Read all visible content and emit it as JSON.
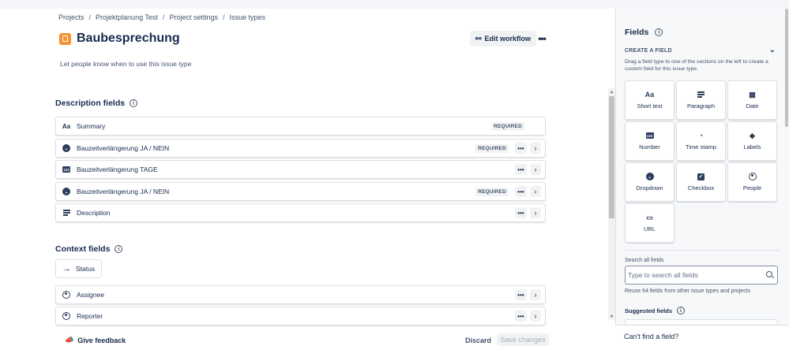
{
  "breadcrumb": [
    "Projects",
    "Projektplanung Test",
    "Project settings",
    "Issue types"
  ],
  "header": {
    "title": "Baubesprechung",
    "edit_workflow": "Edit workflow",
    "description": "Let people know when to use this issue type"
  },
  "description_fields": {
    "title": "Description fields",
    "rows": [
      {
        "icon": "text-icon",
        "label": "Summary",
        "required": "REQUIRED"
      },
      {
        "icon": "dropdown-icon",
        "label": "Bauzeitverlängerung JA / NEIN",
        "required": "REQUIRED"
      },
      {
        "icon": "number-icon",
        "label": "Bauzeitverlängerung TAGE",
        "required": ""
      },
      {
        "icon": "dropdown-icon",
        "label": "Bauzeitverlängerung JA / NEIN",
        "required": "REQUIRED"
      },
      {
        "icon": "paragraph-icon",
        "label": "Description",
        "required": ""
      }
    ]
  },
  "context_fields": {
    "title": "Context fields",
    "status": "Status",
    "rows": [
      {
        "icon": "person-icon",
        "label": "Assignee"
      },
      {
        "icon": "person-icon",
        "label": "Reporter"
      }
    ]
  },
  "footer": {
    "feedback": "Give feedback",
    "discard": "Discard",
    "save": "Save changes"
  },
  "sidebar": {
    "title": "Fields",
    "create_heading": "CREATE A FIELD",
    "create_desc": "Drag a field type to one of the sections on the left to create a custom field for this issue type.",
    "tiles": [
      {
        "icon": "text-icon",
        "label": "Short text"
      },
      {
        "icon": "paragraph-icon",
        "label": "Paragraph"
      },
      {
        "icon": "calendar-icon",
        "label": "Date"
      },
      {
        "icon": "number-icon",
        "label": "Number"
      },
      {
        "icon": "clock-icon",
        "label": "Time stamp"
      },
      {
        "icon": "tag-icon",
        "label": "Labels"
      },
      {
        "icon": "dropdown-icon",
        "label": "Dropdown"
      },
      {
        "icon": "checkbox-icon",
        "label": "Checkbox"
      },
      {
        "icon": "people-icon",
        "label": "People"
      },
      {
        "icon": "link-icon",
        "label": "URL"
      }
    ],
    "search_label": "Search all fields",
    "search_placeholder": "Type to search all fields",
    "reuse_text": "Reuse 64 fields from other issue types and projects",
    "suggested": "Suggested fields",
    "cant_find": "Can't find a field?"
  },
  "icon_glyphs": {
    "text": "Aa",
    "number": "123",
    "edit_workflow": "⚯",
    "more": "•••",
    "arrow_right": "›",
    "status_arrow": "→",
    "feedback": "📣",
    "chevron_down": "⌄",
    "calendar": "▦",
    "clock": "◔",
    "tag": "◆",
    "check": "✓",
    "link": "▭",
    "dropdown": "⌄"
  },
  "colors": {
    "issue_icon": "#f79232",
    "text": "#172b4d",
    "subtle": "#44546f"
  }
}
